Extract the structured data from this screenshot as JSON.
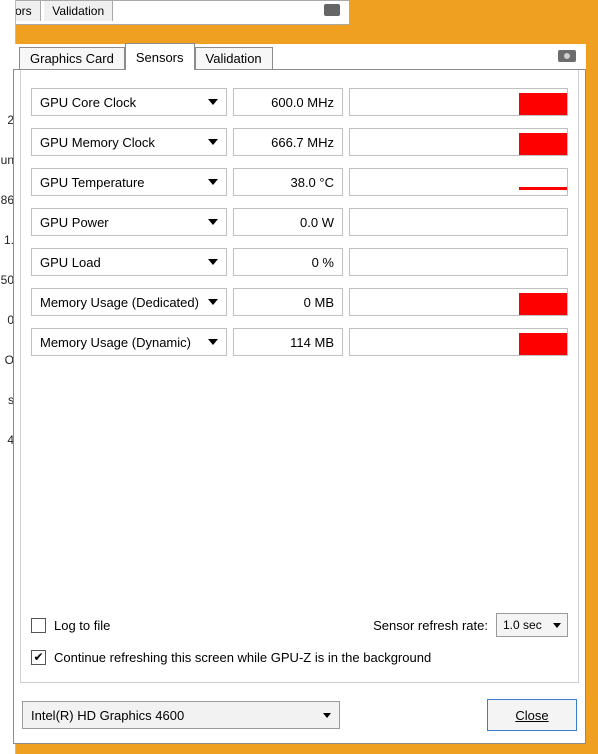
{
  "bg_tabs": {
    "t0": "sors",
    "t1": "Validation"
  },
  "tabs": {
    "graphics": "Graphics Card",
    "sensors": "Sensors",
    "validation": "Validation"
  },
  "sensors": [
    {
      "label": "GPU Core Clock",
      "value": "600.0 MHz",
      "graph": "red"
    },
    {
      "label": "GPU Memory Clock",
      "value": "666.7 MHz",
      "graph": "red"
    },
    {
      "label": "GPU Temperature",
      "value": "38.0 °C",
      "graph": "redthin"
    },
    {
      "label": "GPU Power",
      "value": "0.0 W",
      "graph": ""
    },
    {
      "label": "GPU Load",
      "value": "0 %",
      "graph": ""
    },
    {
      "label": "Memory Usage (Dedicated)",
      "value": "0 MB",
      "graph": "red"
    },
    {
      "label": "Memory Usage (Dynamic)",
      "value": "114 MB",
      "graph": "red"
    }
  ],
  "options": {
    "log_to_file_label": "Log to file",
    "log_checked": false,
    "refresh_label": "Sensor refresh rate:",
    "refresh_value": "1.0 sec",
    "background_label": "Continue refreshing this screen while GPU-Z is in the background",
    "background_checked": true
  },
  "footer": {
    "gpu_select": "Intel(R) HD Graphics 4600",
    "close_label": "Close"
  },
  "left_fragments": [
    "2",
    "un",
    "86",
    "",
    "1.",
    "",
    "50",
    "0",
    "",
    "O",
    "s 4"
  ]
}
